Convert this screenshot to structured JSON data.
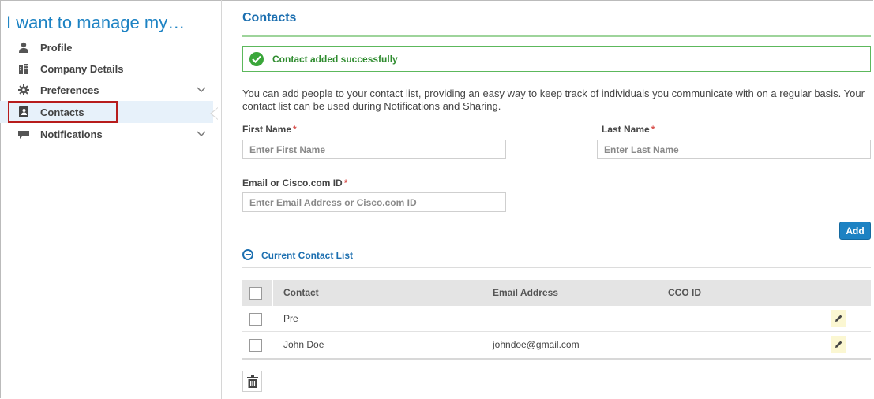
{
  "sidebar": {
    "title": "I want to manage my…",
    "items": [
      {
        "label": "Profile",
        "icon": "user-icon"
      },
      {
        "label": "Company Details",
        "icon": "building-icon"
      },
      {
        "label": "Preferences",
        "icon": "gear-icon",
        "expandable": true
      },
      {
        "label": "Contacts",
        "icon": "address-book-icon",
        "active": true
      },
      {
        "label": "Notifications",
        "icon": "chat-icon",
        "expandable": true
      }
    ]
  },
  "main": {
    "title": "Contacts",
    "alert": "Contact added successfully",
    "description": "You can add people to your contact list, providing an easy way to keep track of individuals you communicate with on a regular basis. Your contact list can be used during Notifications and Sharing.",
    "form": {
      "first_name_label": "First Name",
      "first_name_placeholder": "Enter First Name",
      "last_name_label": "Last Name",
      "last_name_placeholder": "Enter Last Name",
      "email_label": "Email or Cisco.com ID",
      "email_placeholder": "Enter Email Address or Cisco.com ID",
      "required_mark": "*",
      "add_label": "Add"
    },
    "contact_list": {
      "title": "Current Contact List",
      "columns": [
        "Contact",
        "Email Address",
        "CCO ID"
      ],
      "rows": [
        {
          "contact": "Pre",
          "email": "",
          "cco_id": ""
        },
        {
          "contact": "John Doe",
          "email": "johndoe@gmail.com",
          "cco_id": ""
        }
      ]
    }
  },
  "colors": {
    "accent": "#1c82c3",
    "success": "#5cb85c",
    "highlight_border": "#b71c1c"
  }
}
